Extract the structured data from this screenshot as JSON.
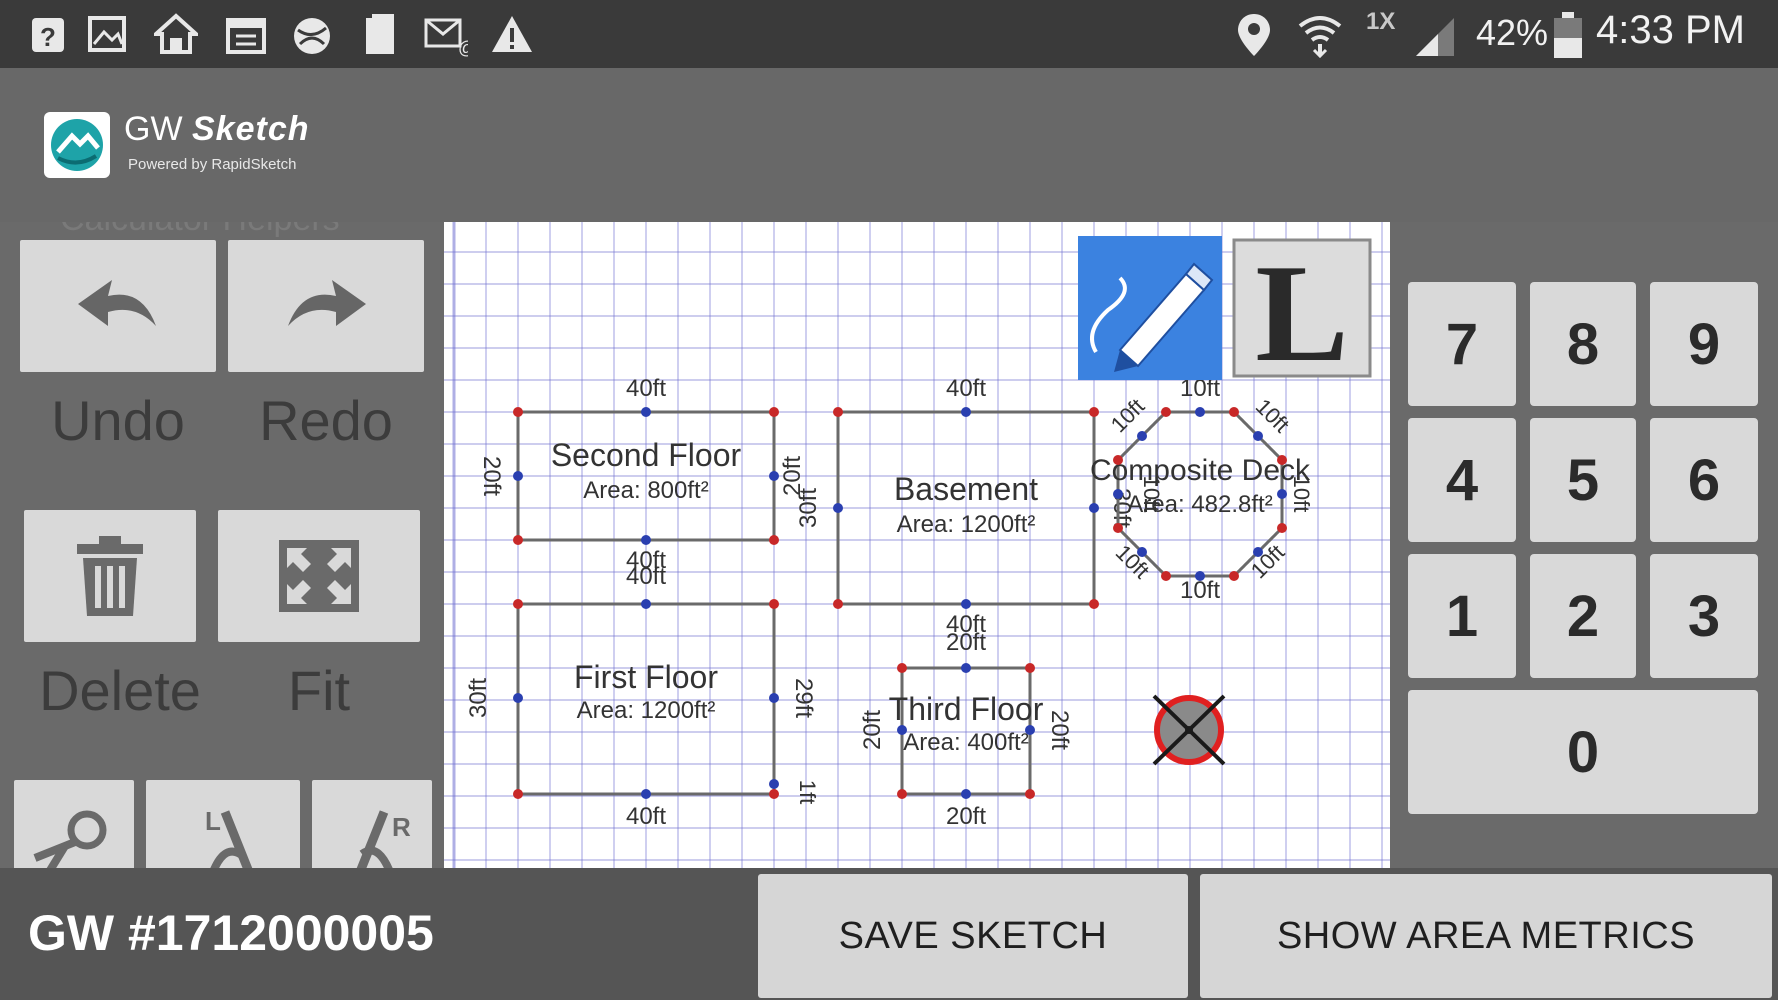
{
  "status_bar": {
    "battery": "42%",
    "time": "4:33 PM",
    "signal_label": "1X",
    "left_icons": [
      "help-icon",
      "image-icon",
      "home-icon",
      "calendar-icon",
      "globe-icon",
      "clipboard-icon",
      "email-icon",
      "warning-icon"
    ],
    "right_icons": [
      "location-pin-icon",
      "wifi-icon",
      "cell-signal-icon",
      "battery-icon"
    ]
  },
  "app": {
    "title_prefix": "GW",
    "title_main": "Sketch",
    "subtitle": "Powered by RapidSketch"
  },
  "tools": {
    "ghost_heading": "Calculator Helpers",
    "undo_label": "Undo",
    "redo_label": "Redo",
    "delete_label": "Delete",
    "fit_label": "Fit"
  },
  "sketch": {
    "second_floor": {
      "name": "Second Floor",
      "area": "Area: 800ft²",
      "top": "40ft",
      "left": "20ft",
      "right": "20ft",
      "bottom": "40ft"
    },
    "first_floor": {
      "name": "First Floor",
      "area": "Area: 1200ft²",
      "top": "40ft",
      "left": "30ft",
      "right": "29ft",
      "right_small": "1ft",
      "bottom": "40ft"
    },
    "basement": {
      "name": "Basement",
      "area": "Area: 1200ft²",
      "top": "40ft",
      "left": "30ft",
      "right": "30ft",
      "bottom": "40ft"
    },
    "third_floor": {
      "name": "Third Floor",
      "area": "Area: 400ft²",
      "top": "20ft",
      "left": "20ft",
      "right": "20ft",
      "bottom": "20ft"
    },
    "deck": {
      "name": "Composite Deck",
      "area": "Area: 482.8ft²",
      "side": "10ft"
    }
  },
  "keypad": {
    "keys": [
      "7",
      "8",
      "9",
      "4",
      "5",
      "6",
      "1",
      "2",
      "3",
      "0"
    ]
  },
  "bottom": {
    "gw_number": "GW #1712000005",
    "save_label": "SAVE SKETCH",
    "metrics_label": "SHOW AREA METRICS"
  },
  "colors": {
    "grid_line": "#6f6fd0",
    "selected_tool": "#3b82e0",
    "vertex_red": "#c82828",
    "vertex_blue": "#2a3fb0"
  }
}
